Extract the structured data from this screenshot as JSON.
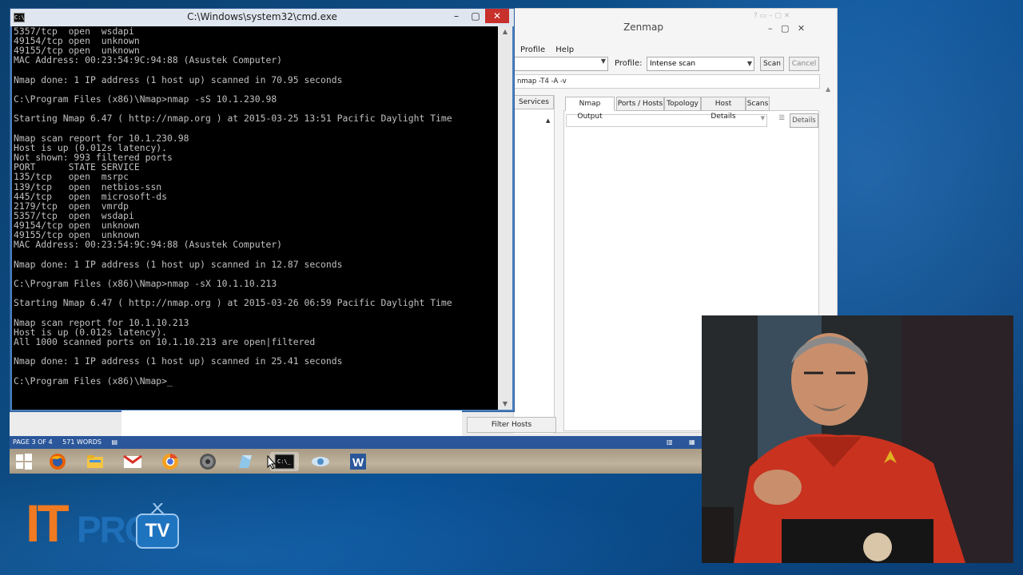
{
  "cmd": {
    "title": "C:\\Windows\\system32\\cmd.exe",
    "lines": [
      "5357/tcp  open  wsdapi",
      "49154/tcp open  unknown",
      "49155/tcp open  unknown",
      "MAC Address: 00:23:54:9C:94:88 (Asustek Computer)",
      "",
      "Nmap done: 1 IP address (1 host up) scanned in 70.95 seconds",
      "",
      "C:\\Program Files (x86)\\Nmap>nmap -sS 10.1.230.98",
      "",
      "Starting Nmap 6.47 ( http://nmap.org ) at 2015-03-25 13:51 Pacific Daylight Time",
      "",
      "Nmap scan report for 10.1.230.98",
      "Host is up (0.012s latency).",
      "Not shown: 993 filtered ports",
      "PORT      STATE SERVICE",
      "135/tcp   open  msrpc",
      "139/tcp   open  netbios-ssn",
      "445/tcp   open  microsoft-ds",
      "2179/tcp  open  vmrdp",
      "5357/tcp  open  wsdapi",
      "49154/tcp open  unknown",
      "49155/tcp open  unknown",
      "MAC Address: 00:23:54:9C:94:88 (Asustek Computer)",
      "",
      "Nmap done: 1 IP address (1 host up) scanned in 12.87 seconds",
      "",
      "C:\\Program Files (x86)\\Nmap>nmap -sX 10.1.10.213",
      "",
      "Starting Nmap 6.47 ( http://nmap.org ) at 2015-03-26 06:59 Pacific Daylight Time",
      "",
      "Nmap scan report for 10.1.10.213",
      "Host is up (0.012s latency).",
      "All 1000 scanned ports on 10.1.10.213 are open|filtered",
      "",
      "Nmap done: 1 IP address (1 host up) scanned in 25.41 seconds",
      "",
      "C:\\Program Files (x86)\\Nmap>_"
    ]
  },
  "zenmap": {
    "title": "Zenmap",
    "menu": [
      "Profile",
      "Help"
    ],
    "profile_label": "Profile:",
    "profile_value": "Intense scan",
    "scan_button": "Scan",
    "cancel_button": "Cancel",
    "command": "nmap -T4 -A -v",
    "left_tab": "Services",
    "tabs": [
      "Nmap Output",
      "Ports / Hosts",
      "Topology",
      "Host Details",
      "Scans"
    ],
    "details_button": "Details",
    "filter_hosts": "Filter Hosts"
  },
  "word": {
    "page": "PAGE 3 OF 4",
    "words": "571 WORDS"
  },
  "taskbar": {
    "icons": [
      "windows-start-icon",
      "firefox-icon",
      "file-explorer-icon",
      "gmail-icon",
      "chrome-canary-icon",
      "media-icon",
      "notepad-icon",
      "cmd-icon",
      "vpn-icon",
      "word-icon"
    ]
  },
  "logo": {
    "it": "IT",
    "pro": "PRO",
    "tv": "TV"
  }
}
